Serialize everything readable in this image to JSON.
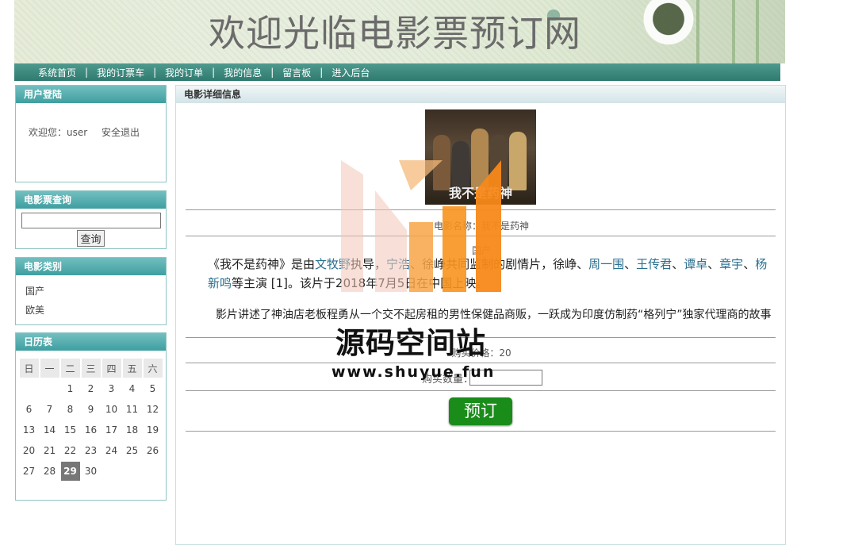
{
  "banner": {
    "title": "欢迎光临电影票预订网"
  },
  "nav": {
    "items": [
      "系统首页",
      "我的订票车",
      "我的订单",
      "我的信息",
      "留言板",
      "进入后台"
    ],
    "separator": "|"
  },
  "login": {
    "title": "用户登陆",
    "welcome": "欢迎您：user",
    "logout": "安全退出"
  },
  "search": {
    "title": "电影票查询",
    "input_value": "",
    "button": "查询"
  },
  "category": {
    "title": "电影类别",
    "items": [
      "国产",
      "欧美"
    ]
  },
  "calendar": {
    "title": "日历表",
    "weekdays": [
      "日",
      "一",
      "二",
      "三",
      "四",
      "五",
      "六"
    ],
    "weeks": [
      [
        "",
        "",
        "1",
        "2",
        "3",
        "4",
        "5"
      ],
      [
        "6",
        "7",
        "8",
        "9",
        "10",
        "11",
        "12"
      ],
      [
        "13",
        "14",
        "15",
        "16",
        "17",
        "18",
        "19"
      ],
      [
        "20",
        "21",
        "22",
        "23",
        "24",
        "25",
        "26"
      ],
      [
        "27",
        "28",
        "29",
        "30",
        "",
        "",
        ""
      ]
    ],
    "today": "29"
  },
  "detail": {
    "title": "电影详细信息",
    "poster_title": "我不是药神",
    "movie_name_line": "电影名称：我不是药神",
    "category_line": "国产",
    "description_parts": [
      {
        "text": "《我不是药神》是由",
        "link": false
      },
      {
        "text": "文牧野",
        "link": true
      },
      {
        "text": "执导，",
        "link": false
      },
      {
        "text": "宁浩",
        "link": true
      },
      {
        "text": "、徐峥共同监制的剧情片，徐峥、",
        "link": false
      },
      {
        "text": "周一围",
        "link": true
      },
      {
        "text": "、",
        "link": false
      },
      {
        "text": "王传君",
        "link": true
      },
      {
        "text": "、",
        "link": false
      },
      {
        "text": "谭卓",
        "link": true
      },
      {
        "text": "、",
        "link": false
      },
      {
        "text": "章宇",
        "link": true
      },
      {
        "text": "、",
        "link": false
      },
      {
        "text": "杨新鸣",
        "link": true
      },
      {
        "text": "等主演 [1]。该片于2018年7月5日在中国上映。",
        "link": false
      }
    ],
    "story": "影片讲述了神油店老板程勇从一个交不起房租的男性保健品商贩，一跃成为印度仿制药“格列宁”独家代理商的故事",
    "price_line": "购买价格：20",
    "qty_label": "购买数量：",
    "qty_value": "",
    "order_button": "预订"
  },
  "watermark": {
    "name": "源码空间站",
    "url": "www.shuyue.fun"
  },
  "colors": {
    "nav": "#2f7a70",
    "panel_head": "#4fa9aa",
    "order_button": "#1a8c1a",
    "link": "#2a6f8f",
    "wm_orange": "#f7931e"
  }
}
